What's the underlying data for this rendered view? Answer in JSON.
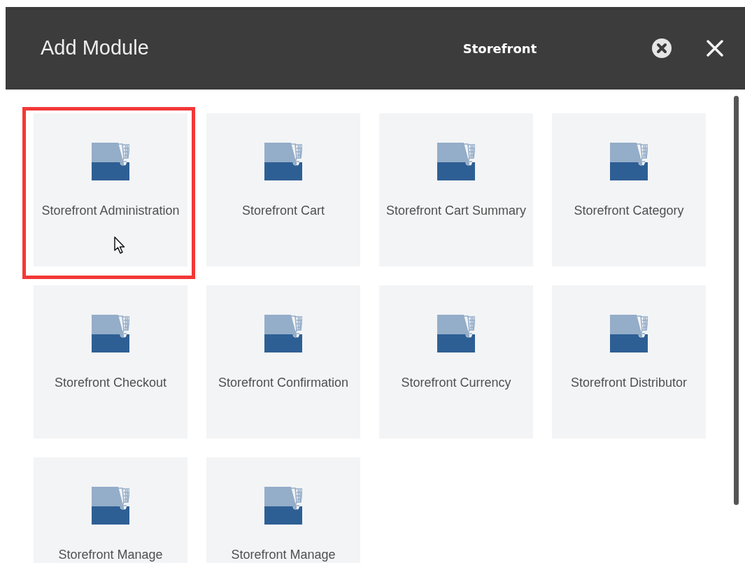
{
  "dialog": {
    "title": "Add Module",
    "category": "Storefront"
  },
  "modules": [
    {
      "label": "Storefront Administration",
      "selected": true
    },
    {
      "label": "Storefront Cart",
      "selected": false
    },
    {
      "label": "Storefront Cart Summary",
      "selected": false
    },
    {
      "label": "Storefront Category",
      "selected": false
    },
    {
      "label": "Storefront Checkout",
      "selected": false
    },
    {
      "label": "Storefront Confirmation",
      "selected": false
    },
    {
      "label": "Storefront Currency",
      "selected": false
    },
    {
      "label": "Storefront Distributor",
      "selected": false
    },
    {
      "label": "Storefront Manage",
      "selected": false
    },
    {
      "label": "Storefront Manage",
      "selected": false
    }
  ]
}
